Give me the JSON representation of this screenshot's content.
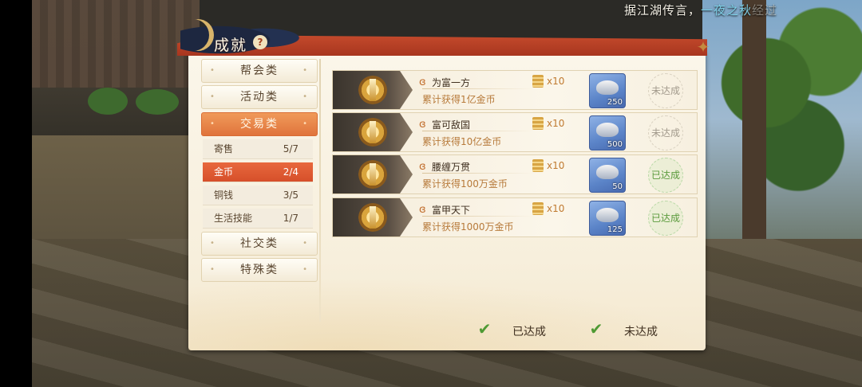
{
  "lore_text": {
    "prefix": "据江湖传言，",
    "highlight": "一夜之秋",
    "suffix": "经过"
  },
  "panel": {
    "title": "成就",
    "help_glyph": "?",
    "close_glyph": "✦"
  },
  "categories": {
    "guild": "帮会类",
    "activity": "活动类",
    "trade": "交易类",
    "social": "社交类",
    "special": "特殊类"
  },
  "subcategories": [
    {
      "label": "寄售",
      "count": "5/7"
    },
    {
      "label": "金币",
      "count": "2/4"
    },
    {
      "label": "铜钱",
      "count": "3/5"
    },
    {
      "label": "生活技能",
      "count": "1/7"
    }
  ],
  "achievements": [
    {
      "name": "为富一方",
      "desc": "累计获得1亿金币",
      "multiplier": "x10",
      "item_qty": "250",
      "status": "未达成"
    },
    {
      "name": "富可敌国",
      "desc": "累计获得10亿金币",
      "multiplier": "x10",
      "item_qty": "500",
      "status": "未达成"
    },
    {
      "name": "腰缠万贯",
      "desc": "累计获得100万金币",
      "multiplier": "x10",
      "item_qty": "50",
      "status": "已达成"
    },
    {
      "name": "富甲天下",
      "desc": "累计获得1000万金币",
      "multiplier": "x10",
      "item_qty": "125",
      "status": "已达成"
    }
  ],
  "filters": {
    "achieved": "已达成",
    "not_achieved": "未达成"
  },
  "icons": {
    "help": "question-icon",
    "close": "close-icon",
    "swirl": "swirl-icon",
    "scroll": "scroll-icon",
    "ingot": "silver-ingot-icon",
    "check": "check-icon"
  },
  "colors": {
    "accent_orange": "#e0743c",
    "active_red": "#d64f2a",
    "achieved_green": "#5a9a3c",
    "panel_bg": "#fbf6ea"
  }
}
